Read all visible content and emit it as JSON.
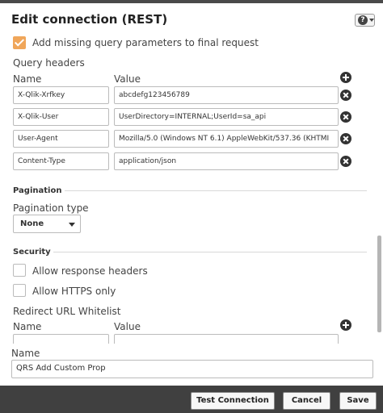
{
  "dialog": {
    "title": "Edit connection (REST)",
    "help_icon": "help-icon"
  },
  "add_missing": {
    "label": "Add missing query parameters to final request",
    "checked": true
  },
  "query_headers": {
    "title": "Query headers",
    "name_col": "Name",
    "value_col": "Value",
    "rows": [
      {
        "name": "X-Qlik-Xrfkey",
        "value": "abcdefg123456789"
      },
      {
        "name": "X-Qlik-User",
        "value": "UserDirectory=INTERNAL;UserId=sa_api"
      },
      {
        "name": "User-Agent",
        "value": "Mozilla/5.0 (Windows NT 6.1) AppleWebKit/537.36 (KHTMI"
      },
      {
        "name": "Content-Type",
        "value": "application/json"
      }
    ]
  },
  "pagination": {
    "title": "Pagination",
    "type_label": "Pagination type",
    "type_value": "None"
  },
  "security": {
    "title": "Security",
    "allow_response_headers": {
      "label": "Allow response headers",
      "checked": false
    },
    "allow_https_only": {
      "label": "Allow HTTPS only",
      "checked": false
    },
    "whitelist_title": "Redirect URL Whitelist",
    "name_col": "Name",
    "value_col": "Value"
  },
  "connection": {
    "name_label": "Name",
    "name_value": "QRS Add Custom Prop"
  },
  "footer": {
    "test_label": "Test Connection",
    "cancel_label": "Cancel",
    "save_label": "Save"
  }
}
